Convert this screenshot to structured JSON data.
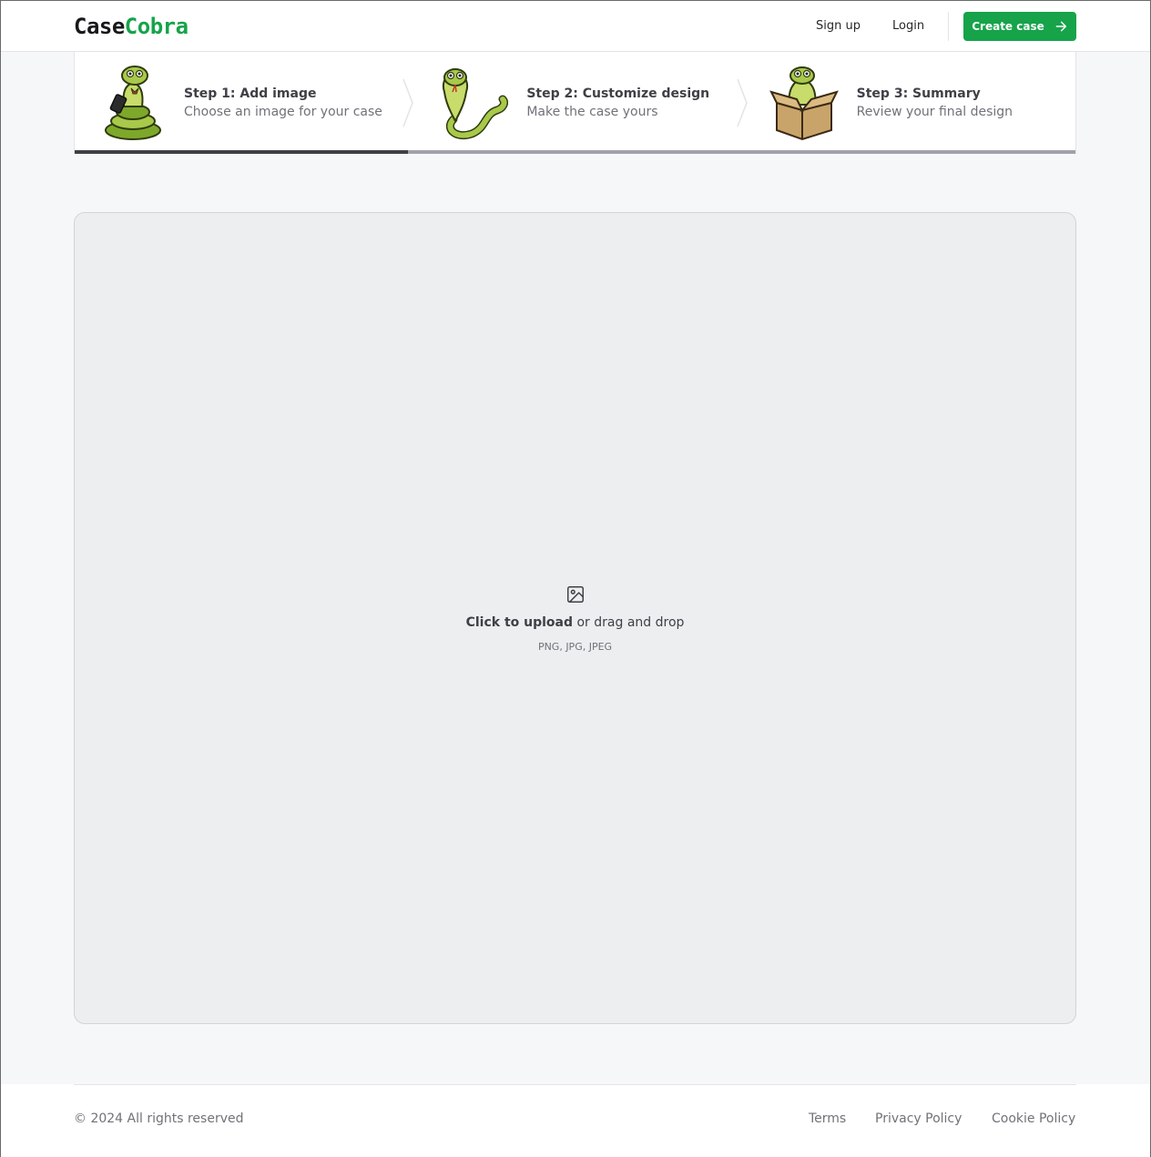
{
  "navbar": {
    "logo_part1": "Case",
    "logo_part2": "Cobra",
    "signup": "Sign up",
    "login": "Login",
    "create_case": "Create case",
    "accent_color": "#16a34a"
  },
  "steps": [
    {
      "title": "Step 1: Add image",
      "description": "Choose an image for your case",
      "mascot": "snake-with-phone-icon",
      "active": true
    },
    {
      "title": "Step 2: Customize design",
      "description": "Make the case yours",
      "mascot": "snake-icon",
      "active": false
    },
    {
      "title": "Step 3: Summary",
      "description": "Review your final design",
      "mascot": "snake-in-box-icon",
      "active": false
    }
  ],
  "dropzone": {
    "icon": "image-icon",
    "upload_strong": "Click to upload",
    "upload_rest": "or drag and drop",
    "formats": "PNG, JPG, JPEG"
  },
  "footer": {
    "copyright": "© 2024 All rights reserved",
    "links": [
      "Terms",
      "Privacy Policy",
      "Cookie Policy"
    ]
  }
}
